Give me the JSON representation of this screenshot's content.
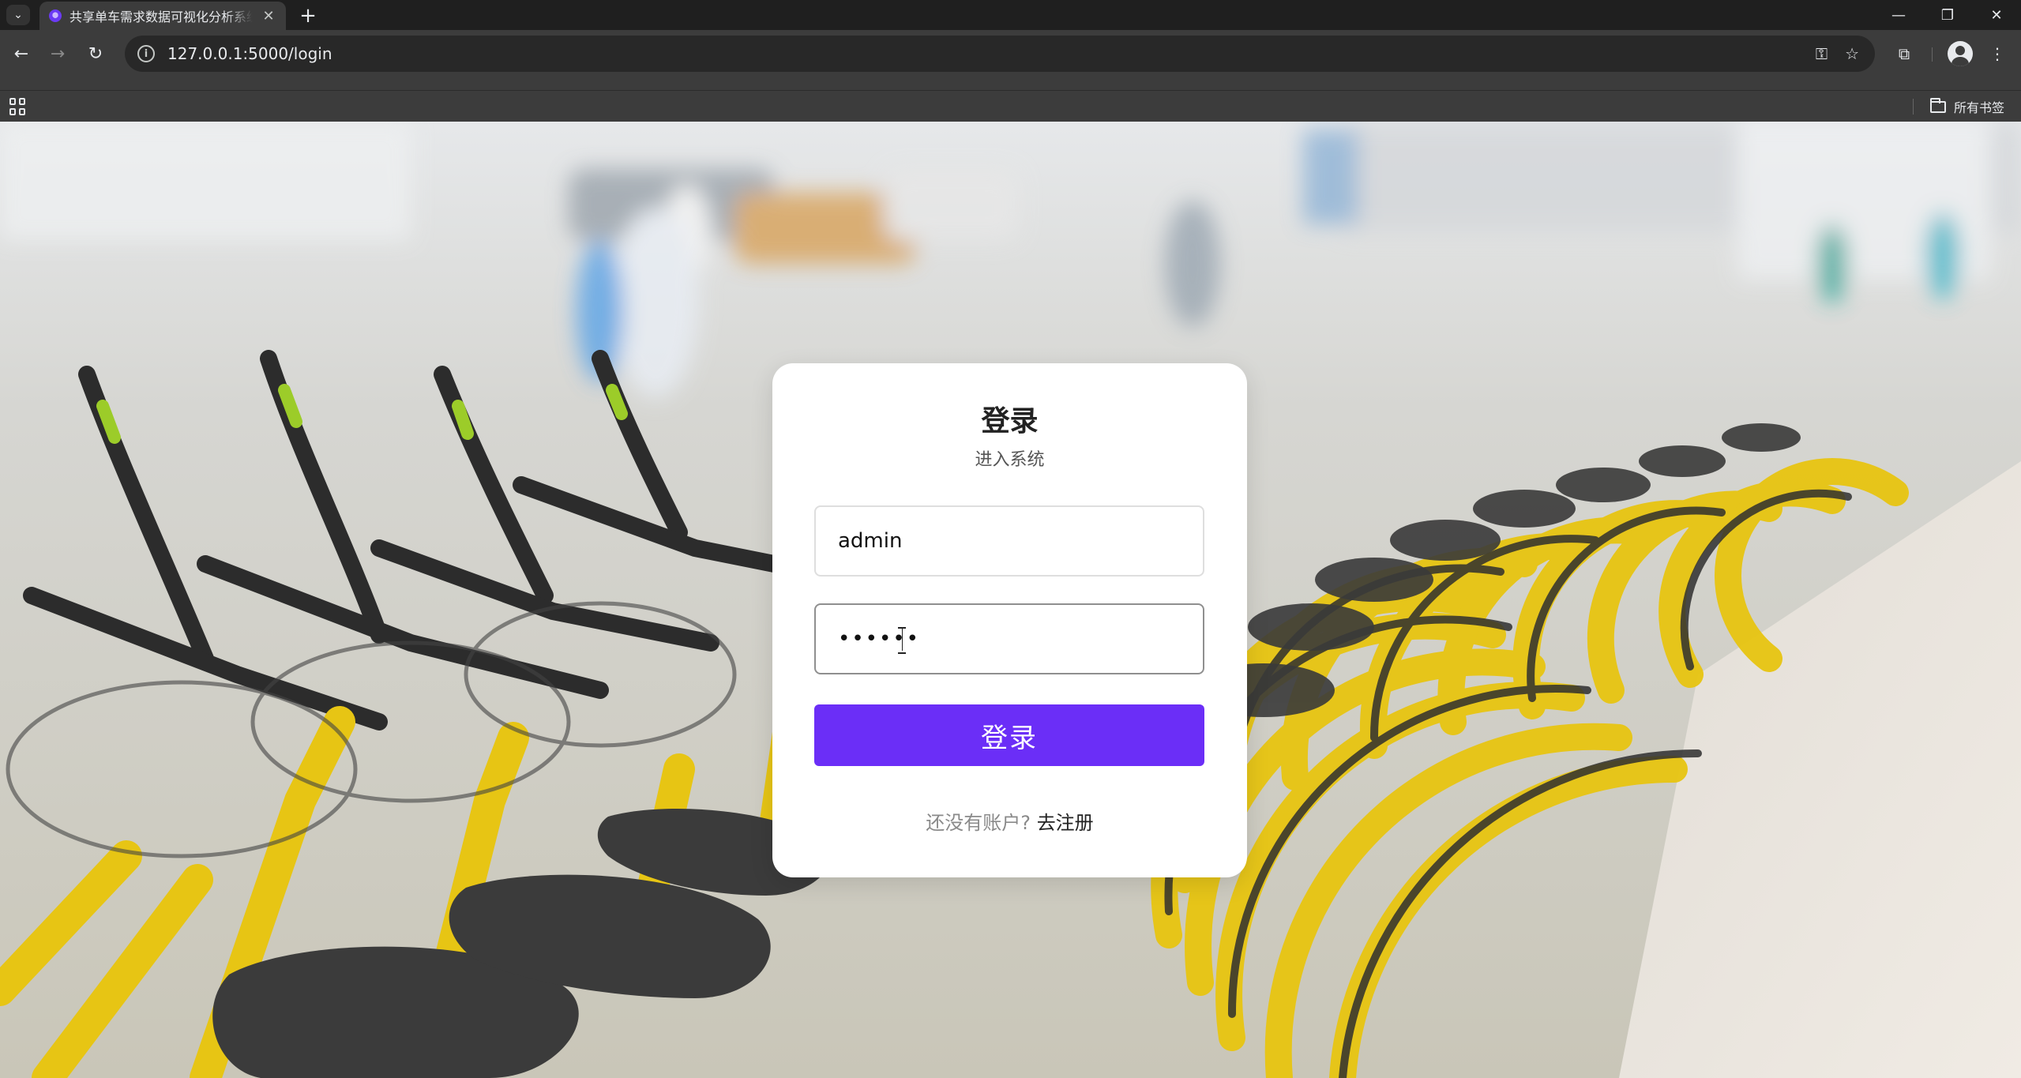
{
  "browser": {
    "tab_title": "共享单车需求数据可视化分析系统",
    "url": "127.0.0.1:5000/login",
    "bookmarks_folder_label": "所有书签"
  },
  "icons": {
    "tab_search": "chevron-down-icon",
    "tab_close": "close-icon",
    "new_tab": "plus-icon",
    "minimize": "minimize-icon",
    "restore": "restore-icon",
    "close_window": "close-icon",
    "back": "back-arrow-icon",
    "forward": "forward-arrow-icon",
    "reload": "reload-icon",
    "site_info": "info-icon",
    "password_key": "key-icon",
    "bookmark_star": "star-icon",
    "extensions": "puzzle-icon",
    "profile": "profile-icon",
    "menu": "more-vert-icon",
    "apps": "apps-grid-icon",
    "folder": "folder-icon"
  },
  "login": {
    "title": "登录",
    "subtitle": "进入系统",
    "username_value": "admin",
    "password_value": "••••••",
    "submit_label": "登录",
    "register_prompt": "还没有账户?",
    "register_link": "去注册"
  },
  "colors": {
    "accent": "#6b2ef7",
    "browser_toolbar": "#3c3c3c",
    "tab_strip": "#1f1f1f"
  }
}
